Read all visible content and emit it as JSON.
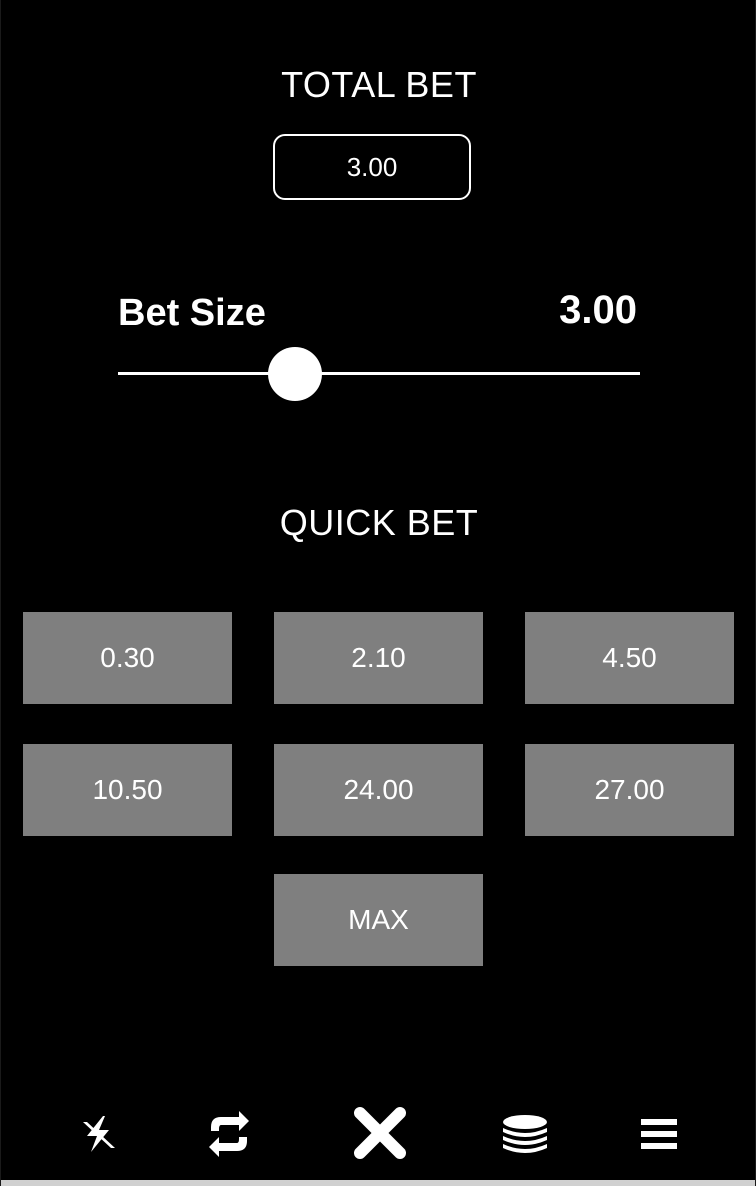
{
  "total_bet": {
    "title": "TOTAL BET",
    "value": "3.00"
  },
  "bet_size": {
    "label": "Bet Size",
    "value": "3.00",
    "slider_level_fraction": 0.34
  },
  "quick_bet": {
    "title": "QUICK BET",
    "options": [
      "0.30",
      "2.10",
      "4.50",
      "10.50",
      "24.00",
      "27.00"
    ],
    "max_label": "MAX"
  },
  "toolbar": {
    "icons": [
      "turbo-icon",
      "autoplay-icon",
      "close-icon",
      "coins-icon",
      "menu-icon"
    ]
  },
  "colors": {
    "background": "#000000",
    "button": "#7f7f7f",
    "text": "#ffffff"
  }
}
